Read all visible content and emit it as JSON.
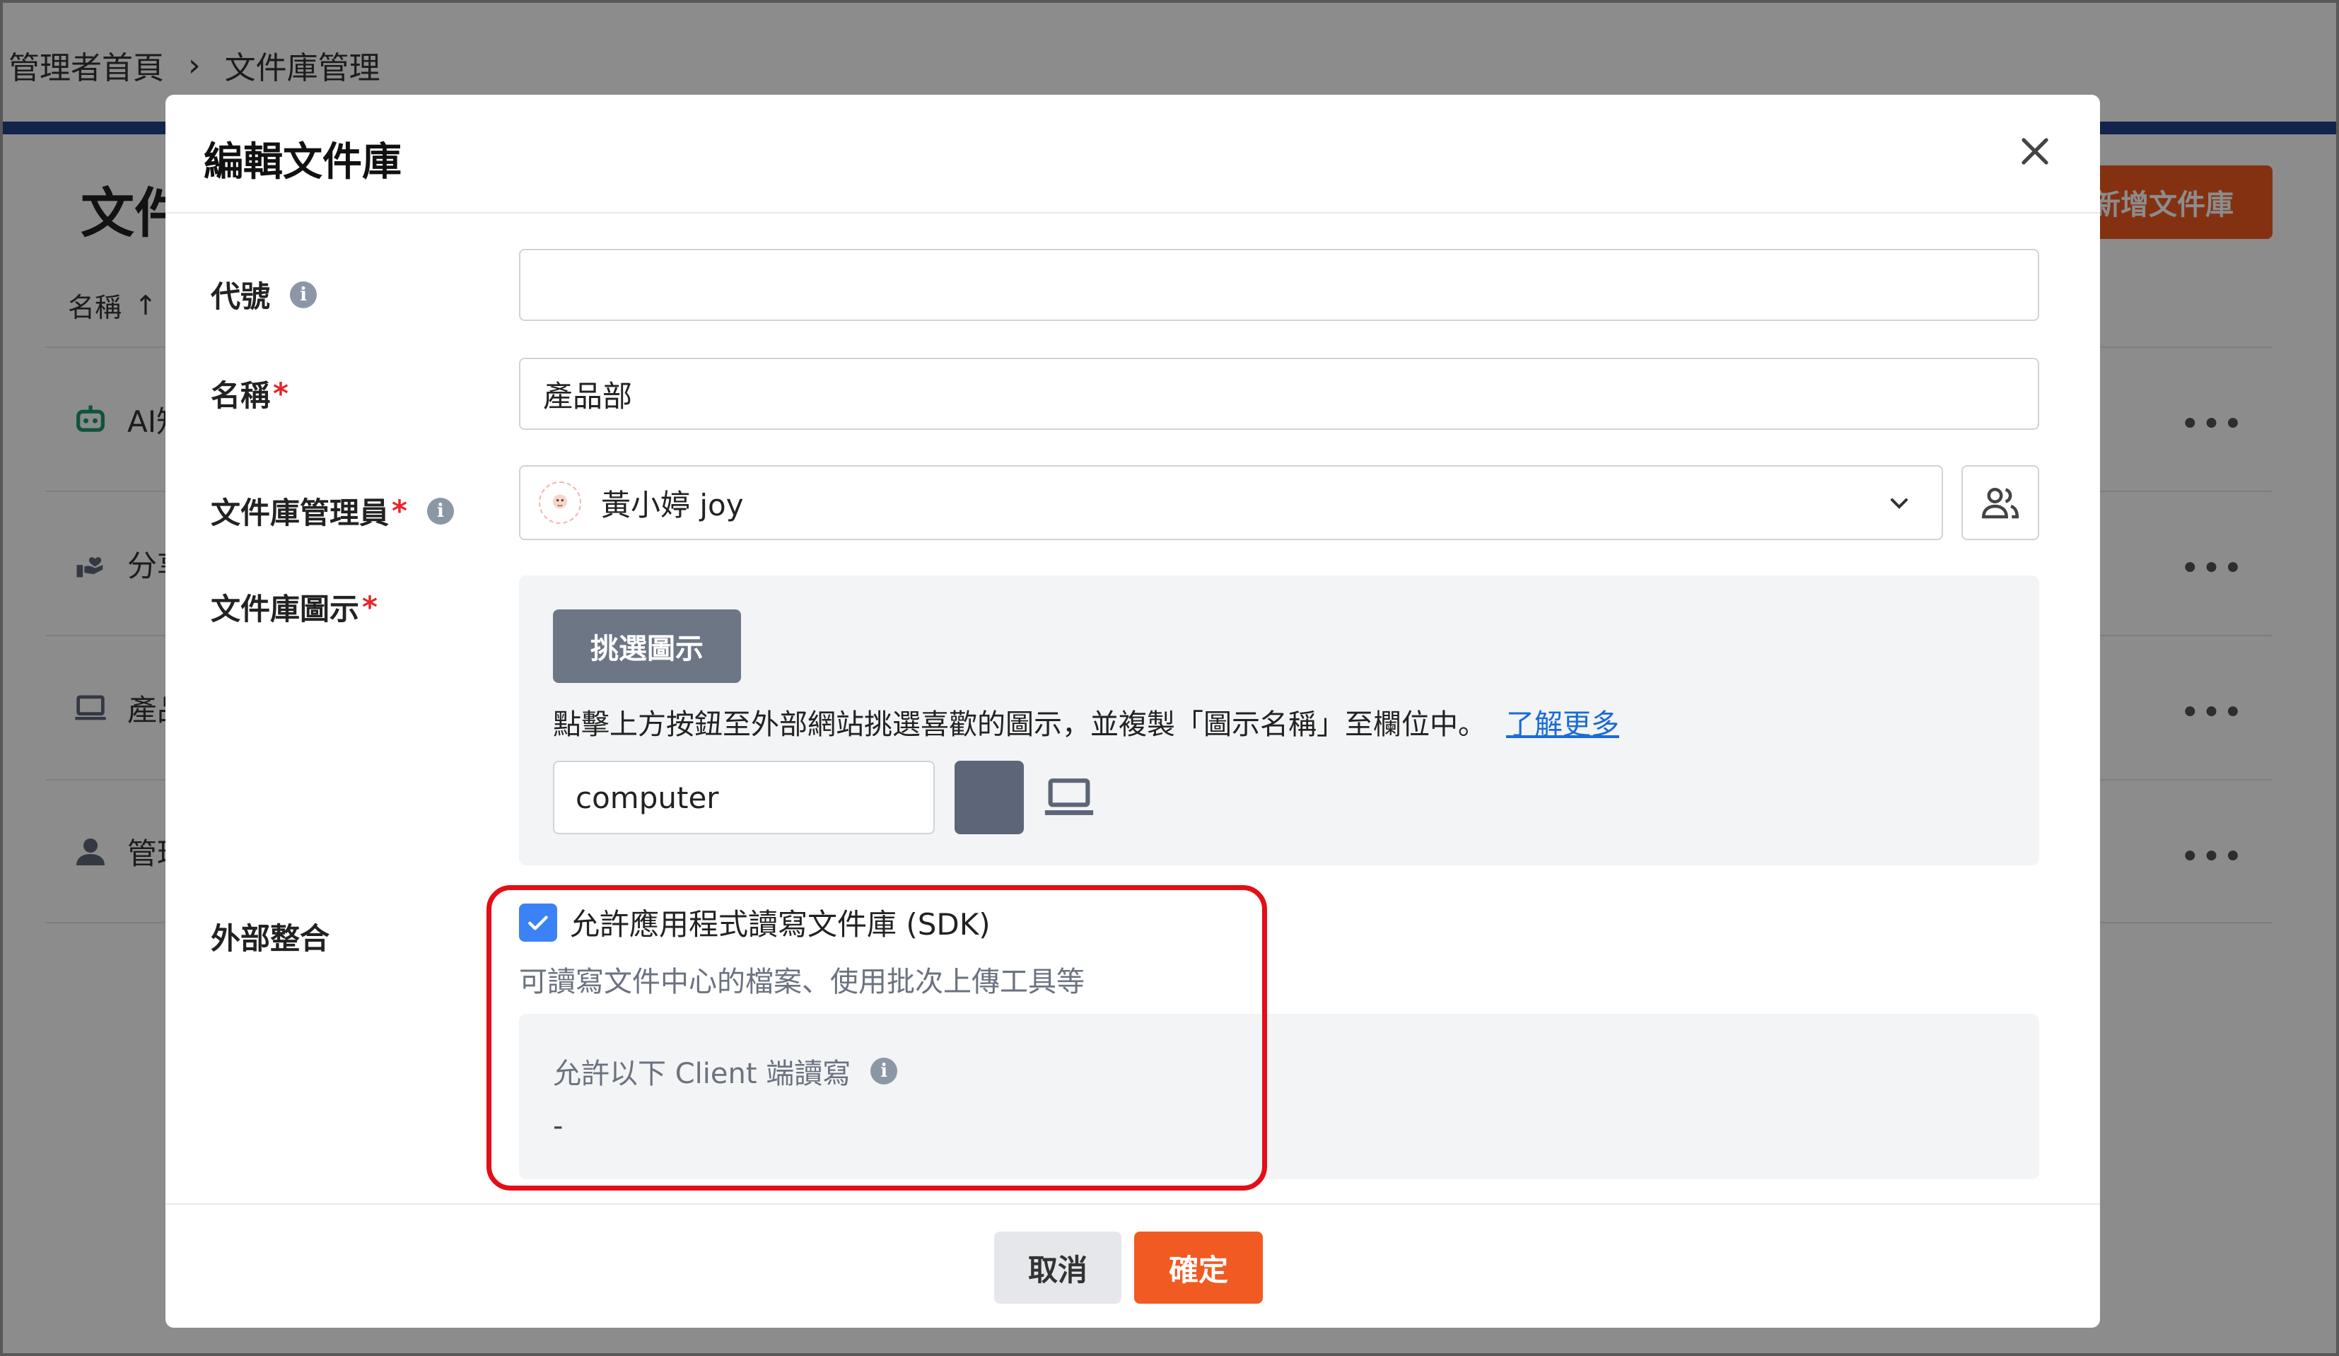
{
  "breadcrumb": {
    "home": "管理者首頁",
    "current": "文件庫管理"
  },
  "background": {
    "title": "文件庫管理",
    "add_button": "新增文件庫",
    "sort_label": "名稱",
    "rows": [
      {
        "name": "AI知識庫",
        "icon": "robot-icon"
      },
      {
        "name": "分享區",
        "icon": "hand-heart-icon"
      },
      {
        "name": "產品部",
        "icon": "laptop-icon"
      },
      {
        "name": "管理部",
        "icon": "person-icon"
      }
    ],
    "more": "•••"
  },
  "modal": {
    "title": "編輯文件庫",
    "fields": {
      "code_label": "代號",
      "code_value": "",
      "name_label": "名稱",
      "name_value": "產品部",
      "admin_label": "文件庫管理員",
      "admin_value": "黃小婷  joy",
      "icon_label": "文件庫圖示",
      "pick_button": "挑選圖示",
      "icon_help": "點擊上方按鈕至外部網站挑選喜歡的圖示，並複製「圖示名稱」至欄位中。",
      "learn_more": "了解更多",
      "icon_name_value": "computer",
      "icon_color": "#5d6678",
      "integration_label": "外部整合",
      "sdk_checkbox_label": "允許應用程式讀寫文件庫 (SDK)",
      "sdk_checked": true,
      "sdk_desc": "可讀寫文件中心的檔案、使用批次上傳工具等",
      "client_title": "允許以下 Client 端讀寫",
      "client_value": "-"
    },
    "cancel": "取消",
    "confirm": "確定"
  },
  "colors": {
    "accent": "#f15a22",
    "navy": "#22418a",
    "checkbox": "#3b82f6",
    "highlight": "#e40e17"
  }
}
